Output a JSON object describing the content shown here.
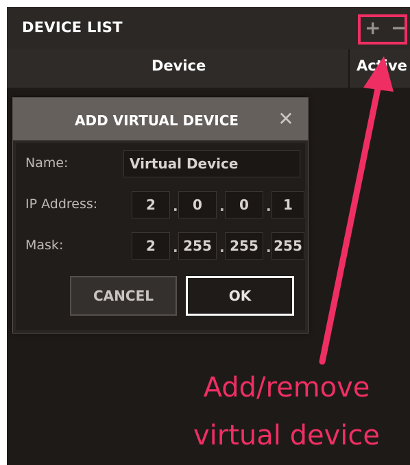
{
  "device_list": {
    "title": "DEVICE LIST",
    "add_label": "+",
    "remove_label": "−",
    "columns": {
      "device": "Device",
      "active": "Active"
    }
  },
  "dialog": {
    "title": "ADD VIRTUAL DEVICE",
    "close_label": "✕",
    "name_label": "Name:",
    "name_value": "Virtual Device",
    "ip_label": "IP Address:",
    "ip_octets": [
      "2",
      "0",
      "0",
      "1"
    ],
    "mask_label": "Mask:",
    "mask_octets": [
      "2",
      "255",
      "255",
      "255"
    ],
    "separator": ".",
    "cancel_label": "CANCEL",
    "ok_label": "OK"
  },
  "annotation": {
    "line1": "Add/remove",
    "line2": "virtual device",
    "color": "#ef2f63"
  },
  "icons": {
    "add": "plus-icon",
    "remove": "minus-icon",
    "close": "close-icon"
  }
}
